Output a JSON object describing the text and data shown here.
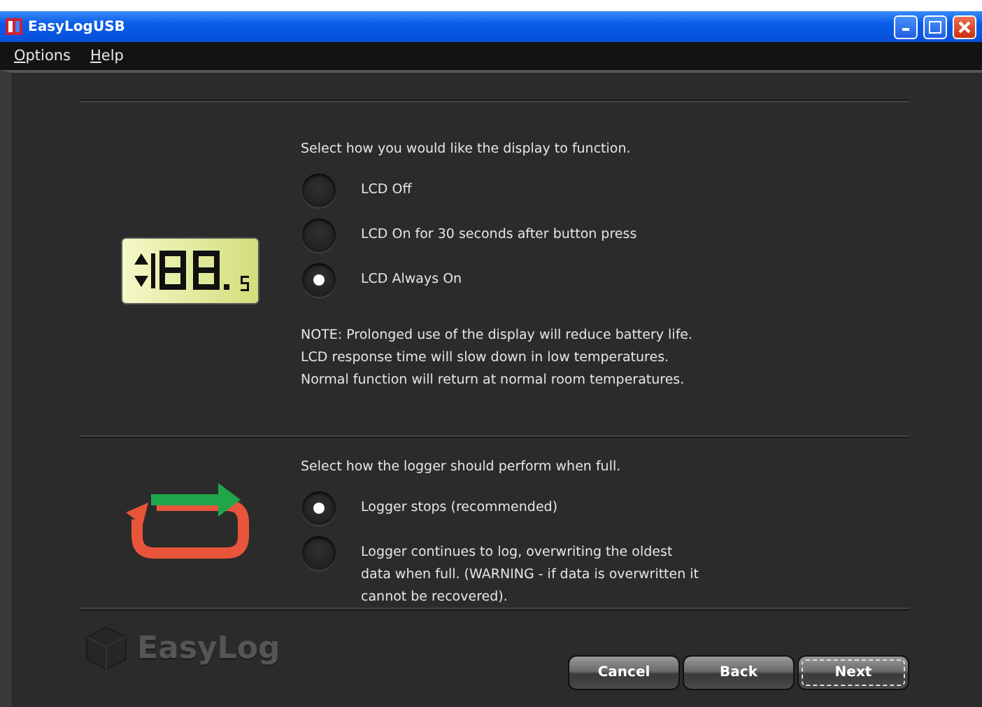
{
  "window": {
    "title": "EasyLogUSB"
  },
  "menu": [
    "Options",
    "Help"
  ],
  "sections": [
    {
      "kind": "lcd",
      "prompt": "Select how you would like the display to function.",
      "options": [
        {
          "label": "LCD Off",
          "selected": false
        },
        {
          "label": "LCD On for 30 seconds after button press",
          "selected": false
        },
        {
          "label": "LCD Always On",
          "selected": true
        }
      ],
      "notes": [
        "NOTE: Prolonged use of the display will reduce battery life.",
        "LCD response time will slow down in low temperatures.",
        "Normal function will return at normal room temperatures."
      ]
    },
    {
      "kind": "loop",
      "prompt": "Select how the logger should perform when full.",
      "options": [
        {
          "label": "Logger stops (recommended)",
          "selected": true
        },
        {
          "label": "Logger continues to log, overwriting the oldest data when full. (WARNING - if data is overwritten it cannot be recovered).",
          "selected": false
        }
      ]
    }
  ],
  "logo_text": "EasyLog",
  "buttons": [
    {
      "label": "Cancel",
      "focused": false
    },
    {
      "label": "Back",
      "focused": false
    },
    {
      "label": "Next",
      "focused": true
    }
  ]
}
